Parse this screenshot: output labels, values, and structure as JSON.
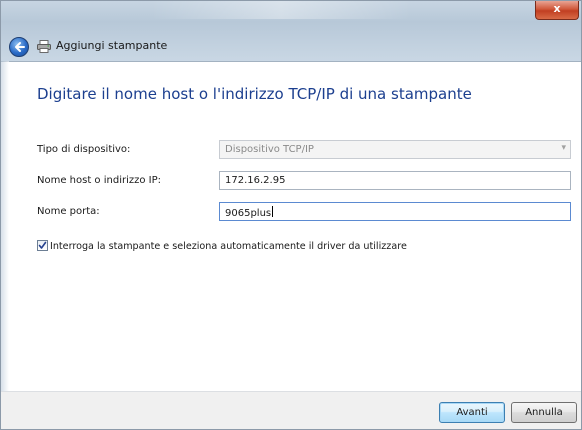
{
  "window": {
    "title": "Aggiungi stampante",
    "close_label": "x"
  },
  "main": {
    "heading": "Digitare il nome host o l'indirizzo TCP/IP di una stampante",
    "fields": [
      {
        "label": "Tipo di dispositivo:",
        "value": "Dispositivo TCP/IP",
        "disabled": true
      },
      {
        "label": "Nome host o indirizzo IP:",
        "value": "172.16.2.95"
      },
      {
        "label": "Nome porta:",
        "value": "9065plus"
      }
    ],
    "checkbox": {
      "label": "Interroga la stampante e seleziona automaticamente il driver da utilizzare",
      "checked": true
    }
  },
  "footer": {
    "next_label": "Avanti",
    "cancel_label": "Annulla"
  },
  "icons": {
    "back": "back-arrow-icon",
    "printer": "printer-icon",
    "dropdown": "chevron-down-icon",
    "check": "check-icon"
  },
  "colors": {
    "heading": "#1c3f8f",
    "default_button_border": "#3c7fb1"
  }
}
